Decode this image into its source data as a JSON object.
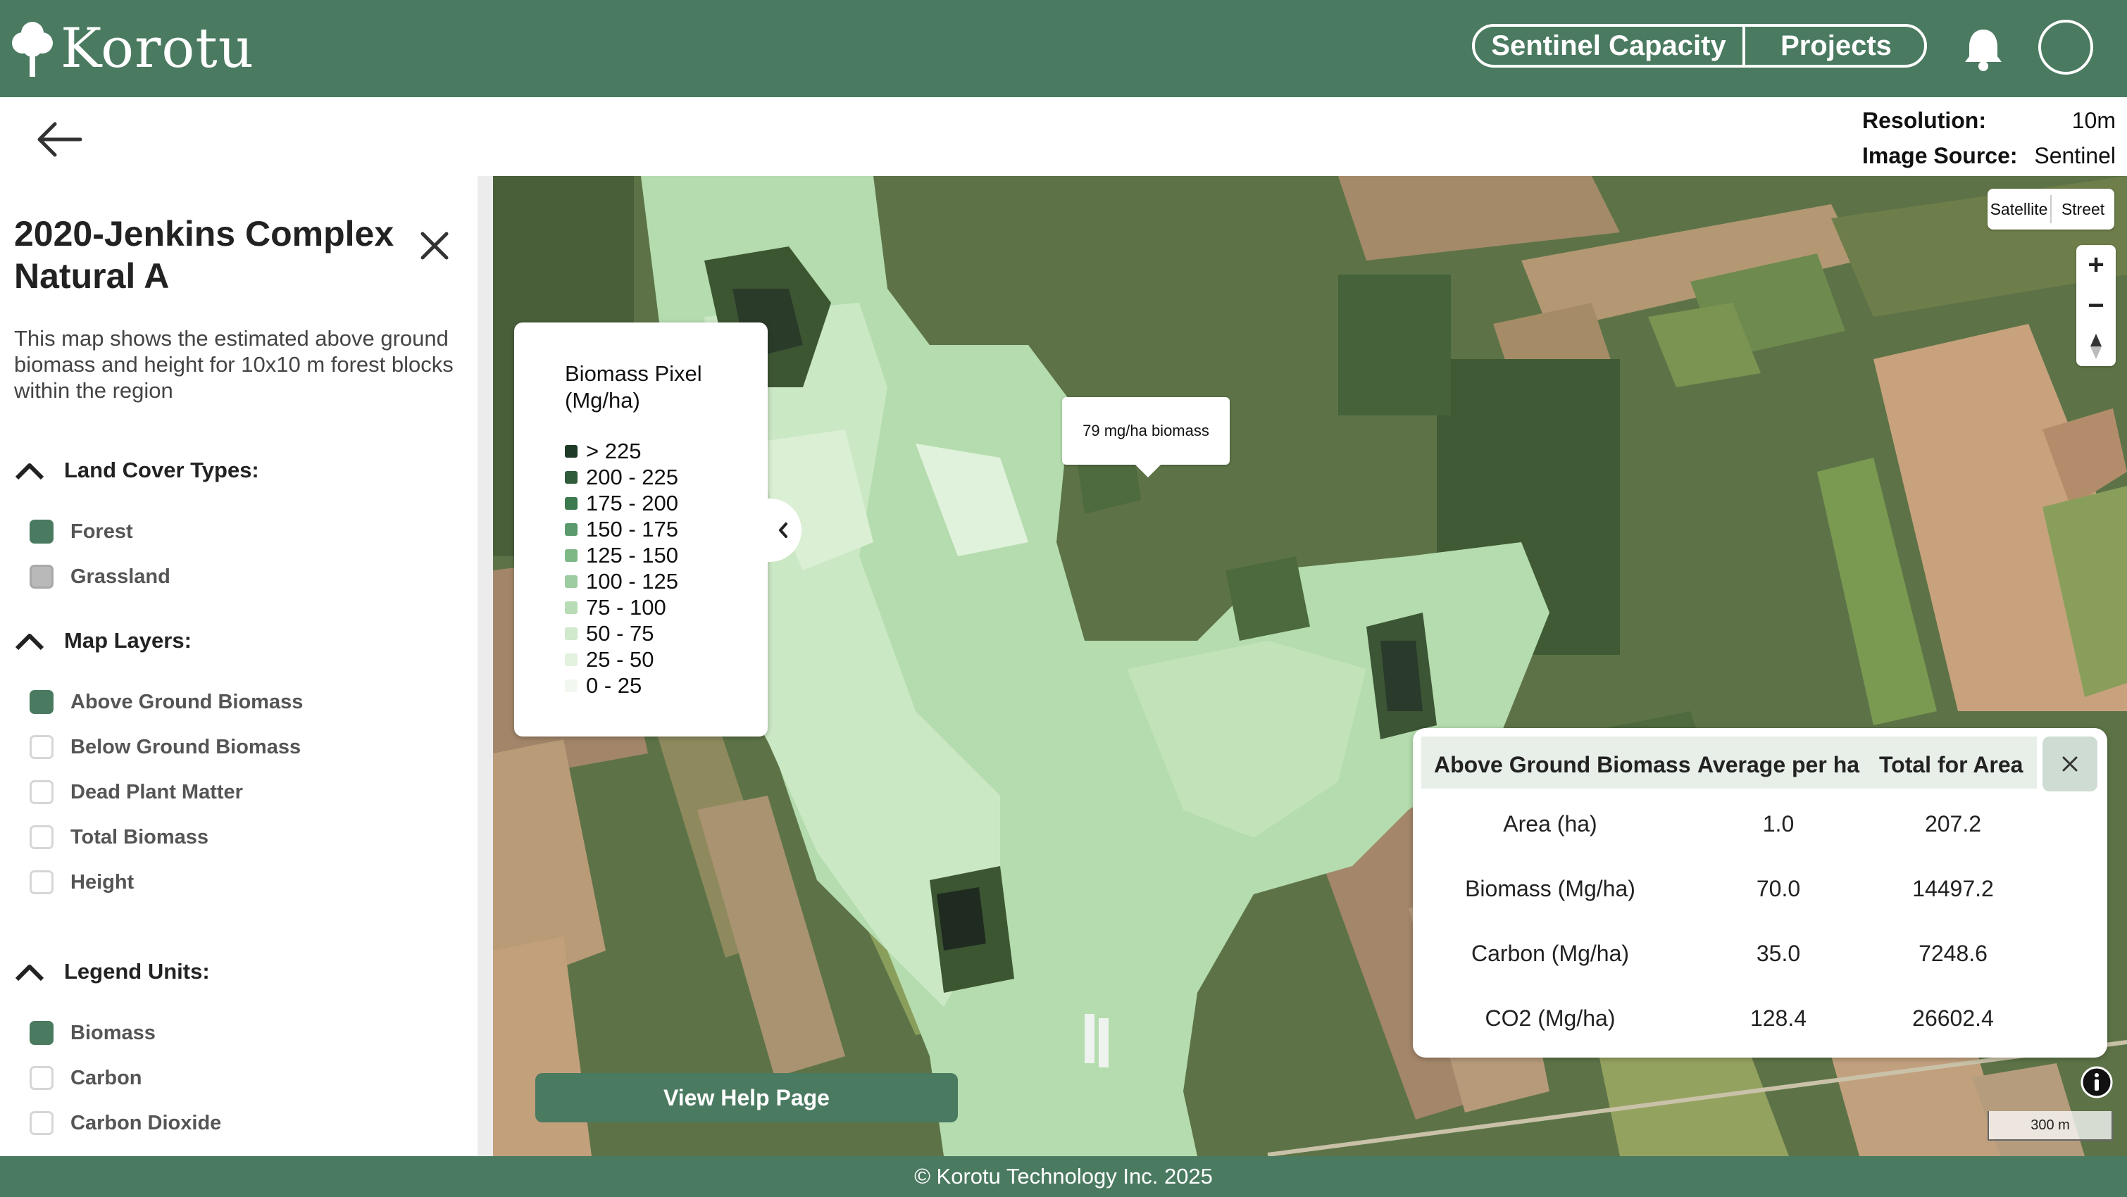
{
  "app": {
    "brand": "Korotu"
  },
  "nav": {
    "sentinel_capacity": "Sentinel Capacity",
    "projects": "Projects"
  },
  "meta": {
    "resolution_label": "Resolution:",
    "resolution_value": "10m",
    "source_label": "Image Source:",
    "source_value": "Sentinel"
  },
  "sidebar": {
    "title": "2020-Jenkins Complex Natural A",
    "description": "This map shows the estimated above ground biomass and height for 10x10 m forest blocks within the region",
    "land_cover": {
      "heading": "Land Cover Types:",
      "options": [
        {
          "label": "Forest",
          "checked": true
        },
        {
          "label": "Grassland",
          "checked": false
        }
      ]
    },
    "map_layers": {
      "heading": "Map Layers:",
      "options": [
        {
          "label": "Above Ground Biomass",
          "checked": true
        },
        {
          "label": "Below Ground Biomass",
          "checked": false
        },
        {
          "label": "Dead Plant Matter",
          "checked": false
        },
        {
          "label": "Total Biomass",
          "checked": false
        },
        {
          "label": "Height",
          "checked": false
        }
      ]
    },
    "legend_units": {
      "heading": "Legend Units:",
      "options": [
        {
          "label": "Biomass",
          "checked": true
        },
        {
          "label": "Carbon",
          "checked": false
        },
        {
          "label": "Carbon Dioxide",
          "checked": false
        }
      ]
    }
  },
  "legend": {
    "title_line1": "Biomass Pixel",
    "title_line2": "(Mg/ha)",
    "items": [
      {
        "label": "> 225",
        "color": "#1f3a26"
      },
      {
        "label": "200 - 225",
        "color": "#2f5b3b"
      },
      {
        "label": "175 - 200",
        "color": "#3e7a50"
      },
      {
        "label": "150 - 175",
        "color": "#5b9a6c"
      },
      {
        "label": "125 - 150",
        "color": "#7db886"
      },
      {
        "label": "100 - 125",
        "color": "#9ccc9f"
      },
      {
        "label": "75 - 100",
        "color": "#b8dcb5"
      },
      {
        "label": "50 - 75",
        "color": "#d0e8cb"
      },
      {
        "label": "25 - 50",
        "color": "#e3f1df"
      },
      {
        "label": "0 - 25",
        "color": "#f2f8ef"
      }
    ]
  },
  "tooltip": {
    "text": "79 mg/ha biomass"
  },
  "map_type": {
    "satellite": "Satellite",
    "street": "Street"
  },
  "stats": {
    "headers": [
      "Above Ground Biomass",
      "Average per ha",
      "Total for Area"
    ],
    "rows": [
      [
        "Area (ha)",
        "1.0",
        "207.2"
      ],
      [
        "Biomass (Mg/ha)",
        "70.0",
        "14497.2"
      ],
      [
        "Carbon (Mg/ha)",
        "35.0",
        "7248.6"
      ],
      [
        "CO2 (Mg/ha)",
        "128.4",
        "26602.4"
      ]
    ]
  },
  "help_button": "View Help Page",
  "scale_label": "300 m",
  "footer": "© Korotu Technology Inc. 2025",
  "colors": {
    "brand": "#4a7a60",
    "biomass_light": "#d6ecd0",
    "biomass_mid": "#a8d8a4"
  }
}
